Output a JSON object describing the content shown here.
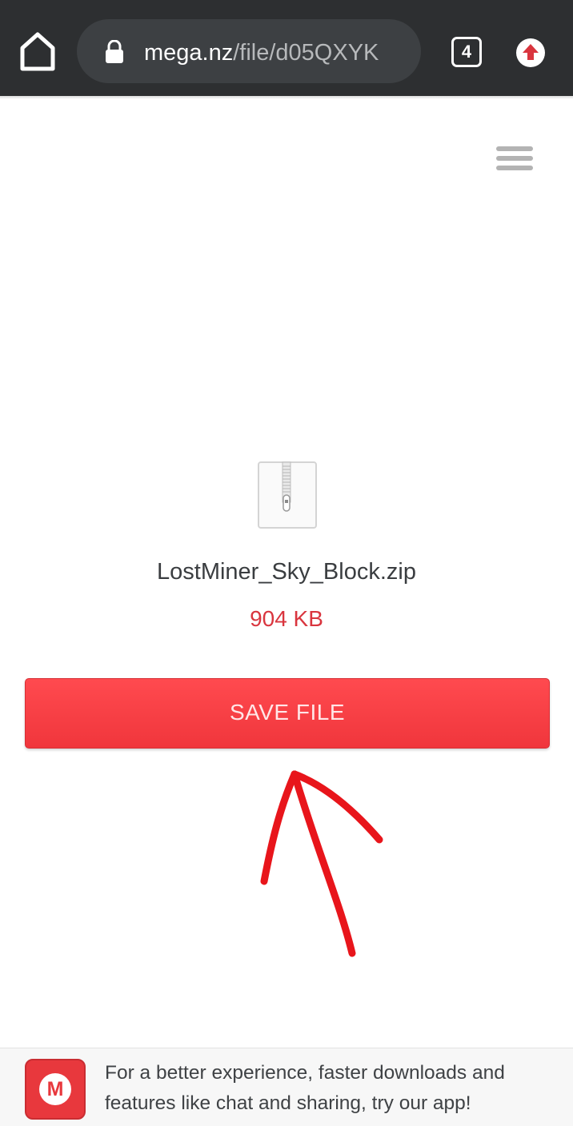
{
  "browser": {
    "url_domain": "mega.nz",
    "url_path": "/file/d05QXYK",
    "tab_count": "4",
    "icons": {
      "home": "home-icon",
      "lock": "lock-icon",
      "update": "update-arrow-icon"
    },
    "colors": {
      "bar": "#2d2f31",
      "pill": "#3d4043",
      "update_red": "#d9353e"
    }
  },
  "page": {
    "menu_icon": "hamburger-menu-icon",
    "file_icon": "zip-file-icon",
    "file_name": "LostMiner_Sky_Block.zip",
    "file_size": "904 KB",
    "save_button_label": "SAVE FILE",
    "annotation_icon": "red-hand-drawn-arrow",
    "colors": {
      "accent": "#f0363c",
      "size_text": "#d9353e"
    }
  },
  "app_banner": {
    "logo_letter": "M",
    "text": "For a better experience, faster downloads and features like chat and sharing, try our app!"
  }
}
